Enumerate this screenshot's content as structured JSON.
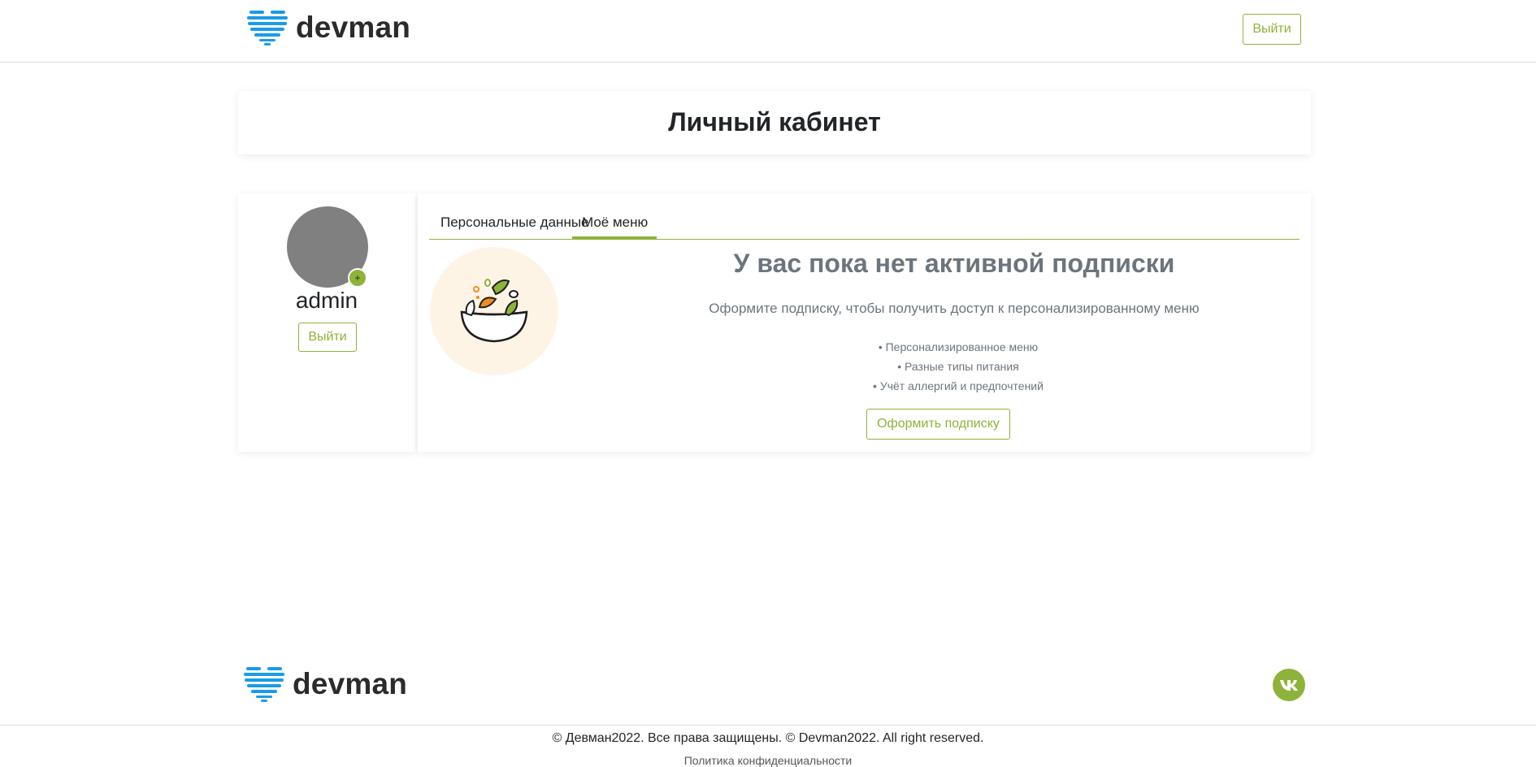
{
  "header": {
    "brand": "devman",
    "logout_label": "Выйти"
  },
  "page": {
    "title": "Личный кабинет"
  },
  "profile": {
    "username": "admin",
    "avatar_add": "+",
    "logout_label": "Выйти"
  },
  "tabs": [
    {
      "label": "Персональные данные",
      "active": false
    },
    {
      "label": "Моё меню",
      "active": true
    }
  ],
  "subscription": {
    "title": "У вас пока нет активной подписки",
    "subtitle": "Оформите подписку, чтобы получить доступ к персонализированному меню",
    "features": [
      "• Персонализированное меню",
      "• Разные типы питания",
      "• Учёт аллергий и предпочтений"
    ],
    "cta_label": "Оформить подписку"
  },
  "footer": {
    "brand": "devman",
    "social": "vk-icon",
    "copyright": "© Девман2022. Все права защищены. © Devman2022. All right reserved.",
    "privacy": "Политика конфиденциальности"
  },
  "colors": {
    "accent": "#8db33a",
    "logo_blue": "#1a9be8",
    "avatar": "#808080",
    "salad_bg": "#fdf4e6"
  }
}
